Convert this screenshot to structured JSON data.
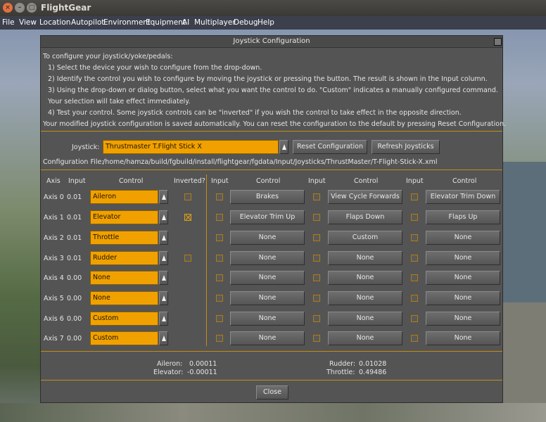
{
  "window": {
    "app_title": "FlightGear"
  },
  "menubar": [
    "File",
    "View",
    "Location",
    "Autopilot",
    "Environment",
    "Equipment",
    "AI",
    "Multiplayer",
    "Debug",
    "Help"
  ],
  "dialog": {
    "title": "Joystick Configuration",
    "instructions": [
      "To configure your joystick/yoke/pedals:",
      "1) Select the device your wish to configure from the drop-down.",
      "2) Identify the control you wish to configure by moving the joystick or pressing the button.  The result is shown in the Input column.",
      "3) Using the drop-down or dialog button, select what you want the control to do.  \"Custom\" indicates a manually configured command.",
      "Your selection will take effect immediately.",
      "4) Test your control.  Some joystick controls can be \"inverted\" if you wish the control to take effect in the opposite direction.",
      "Your modified joystick configuration is saved automatically.  You can reset the configuration to the default by pressing Reset Configuration."
    ],
    "joystick_label": "Joystick:",
    "joystick_value": "Thrustmaster T.Flight Stick X",
    "reset_button": "Reset Configuration",
    "refresh_button": "Refresh Joysticks",
    "config_file_label": "Configuration File:",
    "config_file_path": "/home/hamza/build/fgbuild/install/flightgear/fgdata/Input/Joysticks/ThrustMaster/T-Flight-Stick-X.xml",
    "axis_headers": {
      "axis": "Axis",
      "input": "Input",
      "control": "Control",
      "inverted": "Inverted?"
    },
    "button_headers": {
      "input": "Input",
      "control": "Control"
    },
    "axes": [
      {
        "label": "Axis 0",
        "input": "0.01",
        "control": "Aileron",
        "inverted": false,
        "has_invert": true
      },
      {
        "label": "Axis 1",
        "input": "0.01",
        "control": "Elevator",
        "inverted": true,
        "has_invert": true
      },
      {
        "label": "Axis 2",
        "input": "0.01",
        "control": "Throttle",
        "inverted": false,
        "has_invert": false
      },
      {
        "label": "Axis 3",
        "input": "0.01",
        "control": "Rudder",
        "inverted": false,
        "has_invert": true
      },
      {
        "label": "Axis 4",
        "input": "0.00",
        "control": "None",
        "inverted": false,
        "has_invert": false
      },
      {
        "label": "Axis 5",
        "input": "0.00",
        "control": "None",
        "inverted": false,
        "has_invert": false
      },
      {
        "label": "Axis 6",
        "input": "0.00",
        "control": "Custom",
        "inverted": false,
        "has_invert": false
      },
      {
        "label": "Axis 7",
        "input": "0.00",
        "control": "Custom",
        "inverted": false,
        "has_invert": false
      }
    ],
    "buttons": [
      [
        "Brakes",
        "View Cycle Forwards",
        "Elevator Trim Down"
      ],
      [
        "Elevator Trim Up",
        "Flaps Down",
        "Flaps Up"
      ],
      [
        "None",
        "Custom",
        "None"
      ],
      [
        "None",
        "None",
        "None"
      ],
      [
        "None",
        "None",
        "None"
      ],
      [
        "None",
        "None",
        "None"
      ],
      [
        "None",
        "None",
        "None"
      ],
      [
        "None",
        "None",
        "None"
      ]
    ],
    "status": {
      "aileron_label": "Aileron:",
      "aileron_value": "0.00011",
      "elevator_label": "Elevator:",
      "elevator_value": "-0.00011",
      "rudder_label": "Rudder:",
      "rudder_value": "0.01028",
      "throttle_label": "Throttle:",
      "throttle_value": "0.49486"
    },
    "close_button": "Close"
  },
  "colors": {
    "accent": "#f0a100",
    "divider": "#c48f12",
    "dialog_bg": "#545454",
    "menubar_bg": "#3c3f4c"
  }
}
